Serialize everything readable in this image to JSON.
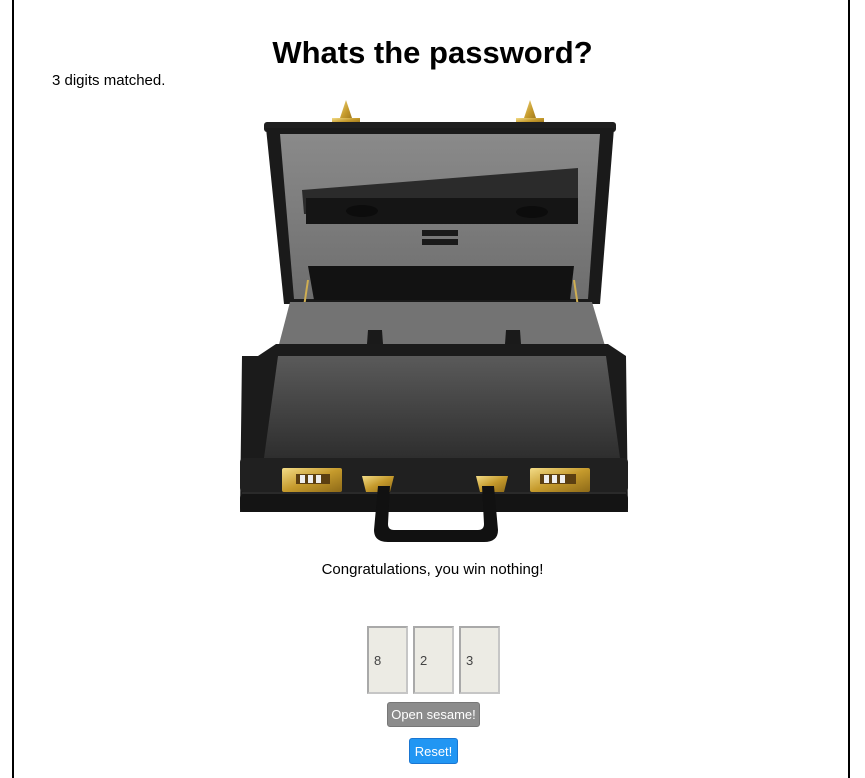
{
  "page": {
    "title": "Whats the password?",
    "status": "3 digits matched.",
    "message": "Congratulations, you win nothing!"
  },
  "combination": {
    "digits": [
      "8",
      "2",
      "3"
    ]
  },
  "buttons": {
    "open_label": "Open sesame!",
    "reset_label": "Reset!"
  },
  "colors": {
    "reset_button": "#2196f3",
    "open_button": "#8c8c8c",
    "digit_background": "#ecebe4",
    "case_body": "#1c1c1c",
    "case_lining": "#7d7d7d",
    "brass": "#d4b24a"
  }
}
